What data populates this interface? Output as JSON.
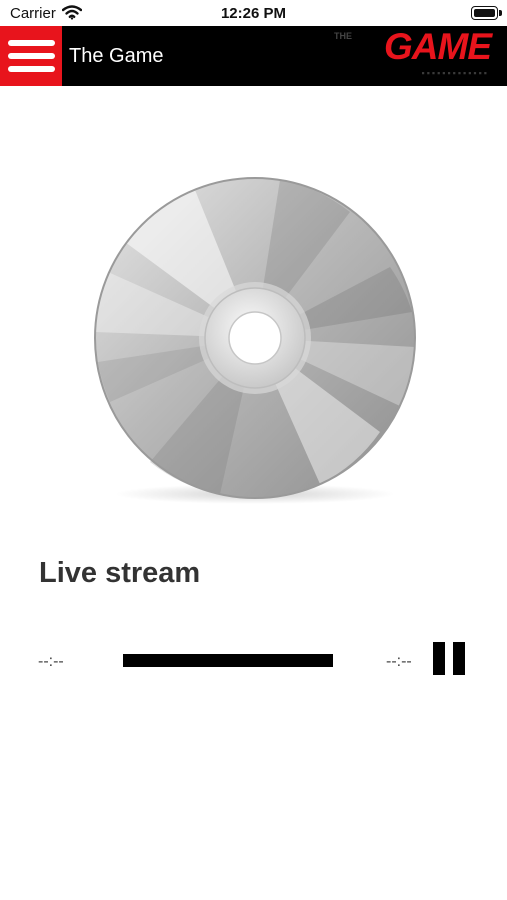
{
  "status_bar": {
    "carrier": "Carrier",
    "time": "12:26 PM",
    "wifi_icon": "wifi-icon",
    "battery_icon": "battery-icon"
  },
  "nav_bar": {
    "title": "The Game",
    "menu_icon": "hamburger-menu-icon",
    "logo_text": "GAME",
    "logo_prefix": "THE",
    "logo_color": "#e8141c",
    "background": "#000000"
  },
  "player": {
    "artwork_icon": "compact-disc-icon",
    "stream_title": "Live stream",
    "elapsed_time": "--:--",
    "remaining_time": "--:--",
    "control_icon": "pause-icon"
  },
  "colors": {
    "accent": "#e8141c",
    "text": "#333333"
  }
}
